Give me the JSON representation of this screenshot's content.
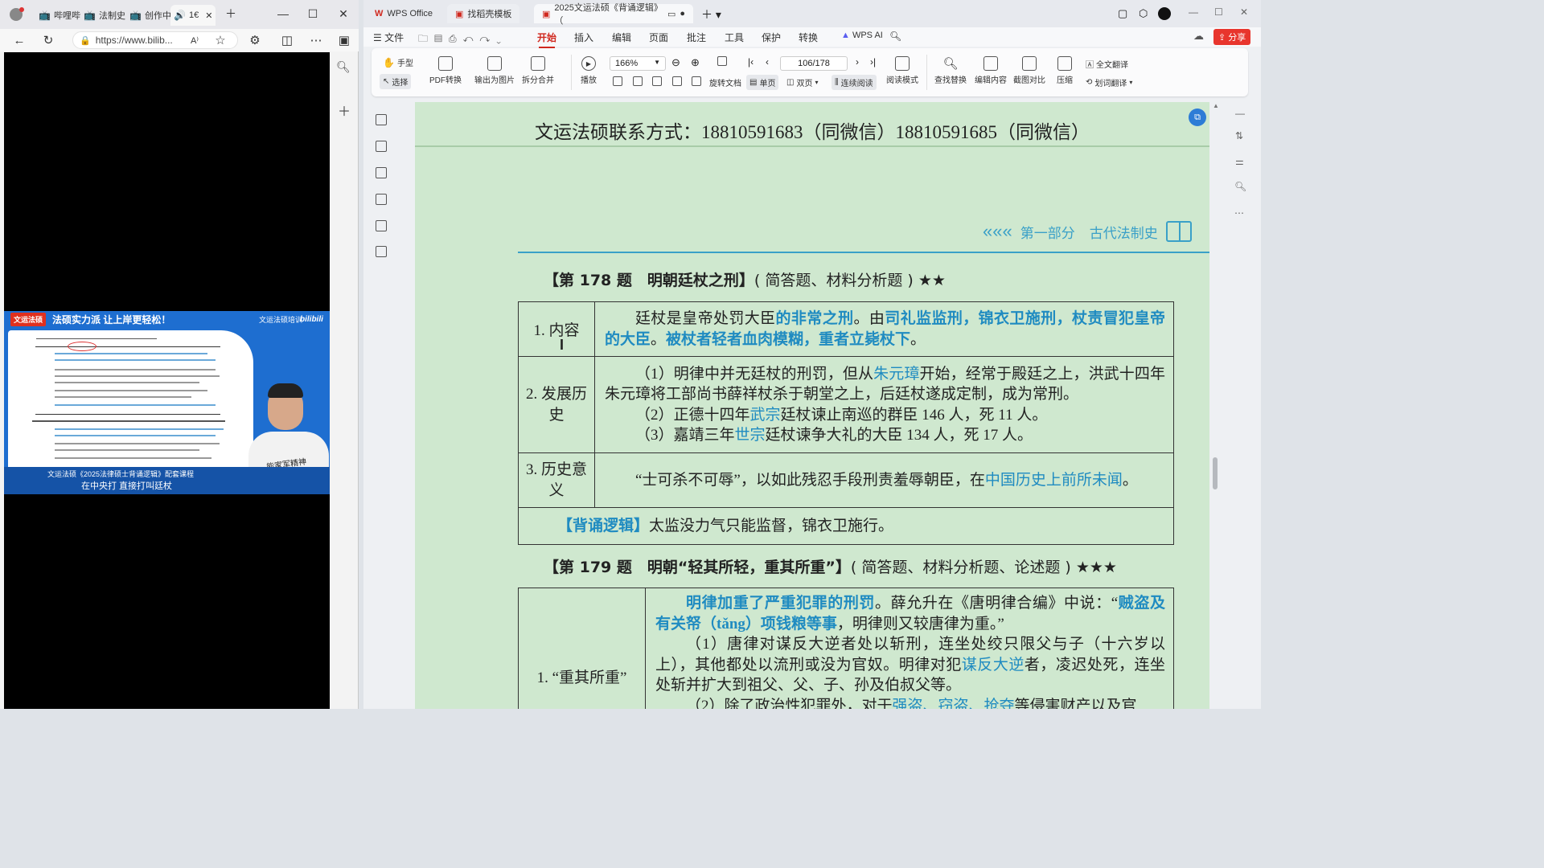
{
  "browser": {
    "tabs": [
      {
        "label": "哔哩哔"
      },
      {
        "label": "法制史"
      },
      {
        "label": "创作中"
      },
      {
        "label": "1€"
      }
    ],
    "address": "https://www.bilib..."
  },
  "video": {
    "banner_brand": "文运法硕",
    "banner_text": "法硕实力派 让上岸更轻松！",
    "banner_right": "文运法硕培训",
    "banner_site": "bilibili",
    "course_caption": "文运法硕《2025法律硕士背诵逻辑》配套课程",
    "subtitle": "在中央打 直接打叫廷杖",
    "tshirt_text": "能家军精神"
  },
  "wps": {
    "tabs": [
      {
        "label": "WPS Office"
      },
      {
        "label": "找稻壳模板"
      },
      {
        "label": "2025文运法硕《背诵逻辑》（"
      }
    ],
    "menu": {
      "file": "文件",
      "items": [
        "开始",
        "插入",
        "编辑",
        "页面",
        "批注",
        "工具",
        "保护",
        "转换"
      ],
      "wps_ai": "WPS AI",
      "share": "分享"
    },
    "ribbon": {
      "hand": "手型",
      "select": "选择",
      "pdf_convert": "PDF转换",
      "export_image": "输出为图片",
      "split_merge": "拆分合并",
      "play": "播放",
      "zoom": "166%",
      "page": "106/178",
      "rotate": "旋转文档",
      "single": "单页",
      "double": "双页",
      "continuous": "连续阅读",
      "read_mode": "阅读模式",
      "find_replace": "查找替换",
      "edit_content": "编辑内容",
      "screenshot_compare": "截图对比",
      "compress": "压缩",
      "full_translate": "全文翻译",
      "word_translate": "划词翻译"
    }
  },
  "doc": {
    "header": "文运法硕联系方式：18810591683（同微信）18810591685（同微信）",
    "section_nav": {
      "arrows": "«««",
      "part": "第一部分",
      "chapter": "古代法制史"
    },
    "q178": {
      "title_num": "【第 178 题　明朝廷杖之刑】",
      "title_tail": "( 简答题、材料分析题 ) ★★",
      "rows": [
        {
          "label": "1. 内容",
          "t1": "廷杖是皇帝处罚大臣",
          "h1": "的非常之刑",
          "t2": "。由",
          "h2": "司礼监监刑，锦衣卫施刑，杖责冒犯皇帝的大臣",
          "t3": "。",
          "h3": "被杖者轻者血肉模糊，重者立毙杖下",
          "t4": "。"
        },
        {
          "label": "2. 发展历史",
          "p1a": "（1）明律中并无廷杖的刑罚，但从",
          "p1h": "朱元璋",
          "p1b": "开始，经常于殿廷之上，洪武十四年朱元璋将工部尚书薛祥杖杀于朝堂之上，后廷杖遂成定制，成为常刑。",
          "p2a": "（2）正德十四年",
          "p2h": "武宗",
          "p2b": "廷杖谏止南巡的群臣 146 人，死 11 人。",
          "p3a": "（3）嘉靖三年",
          "p3h": "世宗",
          "p3b": "廷杖谏争大礼的大臣 134 人，死 17 人。"
        },
        {
          "label": "3. 历史意义",
          "t1": "“士可杀不可辱”，以如此残忍手段刑责羞辱朝臣，在",
          "h1": "中国历史上前所未闻",
          "t2": "。"
        }
      ],
      "logic_tag": "【背诵逻辑】",
      "logic_text": "太监没力气只能监督，锦衣卫施行。"
    },
    "q179": {
      "title_num": "【第 179 题　明朝“轻其所轻，重其所重”】",
      "title_tail": "( 简答题、材料分析题、论述题 ) ★★★",
      "label": "1. “重其所重”",
      "h1": "明律加重了严重犯罪的刑罚",
      "t1": "。薛允升在《唐明律合编》中说：“",
      "h2": "贼盗及有关帑（tǎng）项钱粮等事",
      "t2": "，明律则又较唐律为重。”",
      "p1a": "（1）唐律对谋反大逆者处以斩刑，连坐处绞只限父与子（十六岁以上），其他都处以流刑或没为官奴。明律对犯",
      "p1h": "谋反大逆",
      "p1b": "者，凌迟处死，连坐处斩并扩大到祖父、父、子、孙及伯叔父等。",
      "p2a": "（2）除了政治性犯罪外，对于",
      "p2h": "强盗、窃盗、抢夺",
      "p2b": "等侵害财产以及官"
    }
  }
}
